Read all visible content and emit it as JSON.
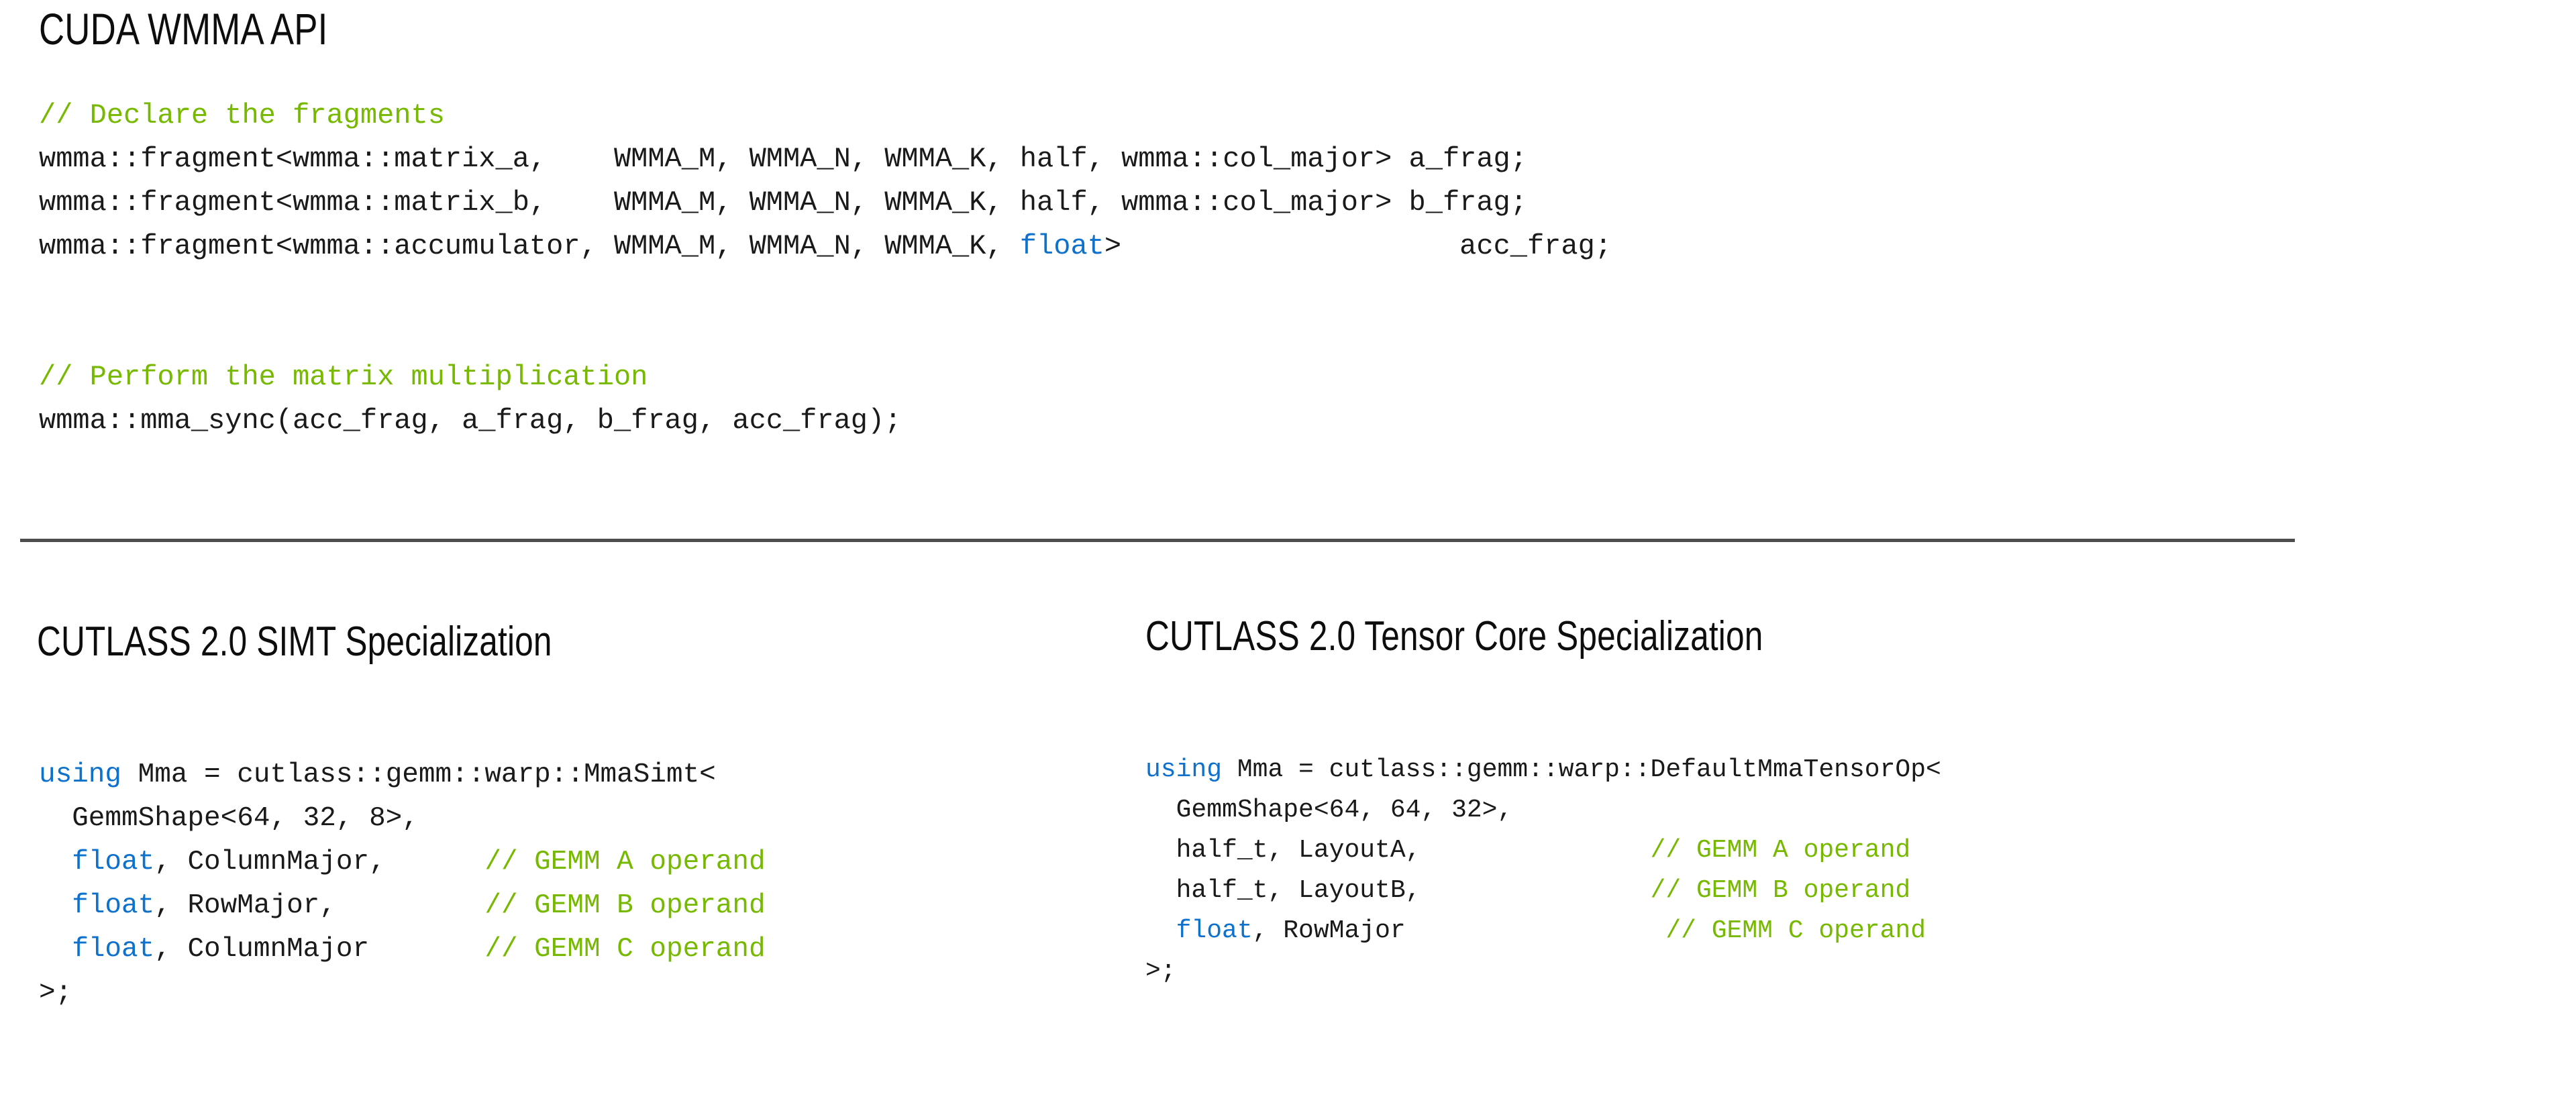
{
  "colors": {
    "comment_green": "#76b900",
    "keyword_blue": "#0e72cc",
    "code_text": "#1a1a1a",
    "heading_text": "#0d0d0d",
    "divider": "#4d4d4d",
    "background": "#ffffff"
  },
  "sections": {
    "top": {
      "heading": "CUDA WMMA API",
      "code_lines": [
        {
          "tokens": [
            {
              "t": "// Declare the fragments",
              "c": "cm"
            }
          ]
        },
        {
          "tokens": [
            {
              "t": "wmma::fragment<wmma::matrix_a,    WMMA_M, WMMA_N, WMMA_K, half, wmma::col_major> a_frag;",
              "c": "pl"
            }
          ]
        },
        {
          "tokens": [
            {
              "t": "wmma::fragment<wmma::matrix_b,    WMMA_M, WMMA_N, WMMA_K, half, wmma::col_major> b_frag;",
              "c": "pl"
            }
          ]
        },
        {
          "tokens": [
            {
              "t": "wmma::fragment<wmma::accumulator, WMMA_M, WMMA_N, WMMA_K, ",
              "c": "pl"
            },
            {
              "t": "float",
              "c": "kw"
            },
            {
              "t": ">                    acc_frag;",
              "c": "pl"
            }
          ]
        },
        {
          "tokens": [
            {
              "t": "",
              "c": "pl"
            }
          ]
        },
        {
          "tokens": [
            {
              "t": "",
              "c": "pl"
            }
          ]
        },
        {
          "tokens": [
            {
              "t": "// Perform the matrix multiplication",
              "c": "cm"
            }
          ]
        },
        {
          "tokens": [
            {
              "t": "wmma::mma_sync(acc_frag, a_frag, b_frag, acc_frag);",
              "c": "pl"
            }
          ]
        }
      ]
    },
    "left": {
      "heading": "CUTLASS 2.0 SIMT Specialization",
      "code_lines": [
        {
          "tokens": [
            {
              "t": "using",
              "c": "kw"
            },
            {
              "t": " Mma = cutlass::gemm::warp::MmaSimt<",
              "c": "pl"
            }
          ]
        },
        {
          "tokens": [
            {
              "t": "  GemmShape<64, 32, 8>,",
              "c": "pl"
            }
          ]
        },
        {
          "tokens": [
            {
              "t": "  ",
              "c": "pl"
            },
            {
              "t": "float",
              "c": "kw"
            },
            {
              "t": ", ColumnMajor,      ",
              "c": "pl"
            },
            {
              "t": "// GEMM A operand",
              "c": "cm"
            }
          ]
        },
        {
          "tokens": [
            {
              "t": "  ",
              "c": "pl"
            },
            {
              "t": "float",
              "c": "kw"
            },
            {
              "t": ", RowMajor,         ",
              "c": "pl"
            },
            {
              "t": "// GEMM B operand",
              "c": "cm"
            }
          ]
        },
        {
          "tokens": [
            {
              "t": "  ",
              "c": "pl"
            },
            {
              "t": "float",
              "c": "kw"
            },
            {
              "t": ", ColumnMajor       ",
              "c": "pl"
            },
            {
              "t": "// GEMM C operand",
              "c": "cm"
            }
          ]
        },
        {
          "tokens": [
            {
              "t": ">;",
              "c": "pl"
            }
          ]
        }
      ]
    },
    "right": {
      "heading": "CUTLASS 2.0 Tensor Core Specialization",
      "code_lines": [
        {
          "tokens": [
            {
              "t": "using",
              "c": "kw"
            },
            {
              "t": " Mma = cutlass::gemm::warp::DefaultMmaTensorOp<",
              "c": "pl"
            }
          ]
        },
        {
          "tokens": [
            {
              "t": "  GemmShape<64, 64, 32>,",
              "c": "pl"
            }
          ]
        },
        {
          "tokens": [
            {
              "t": "  half_t, LayoutA,               ",
              "c": "pl"
            },
            {
              "t": "// GEMM A operand",
              "c": "cm"
            }
          ]
        },
        {
          "tokens": [
            {
              "t": "  half_t, LayoutB,               ",
              "c": "pl"
            },
            {
              "t": "// GEMM B operand",
              "c": "cm"
            }
          ]
        },
        {
          "tokens": [
            {
              "t": "  ",
              "c": "pl"
            },
            {
              "t": "float",
              "c": "kw"
            },
            {
              "t": ", RowMajor                 ",
              "c": "pl"
            },
            {
              "t": "// GEMM C operand",
              "c": "cm"
            }
          ]
        },
        {
          "tokens": [
            {
              "t": ">;",
              "c": "pl"
            }
          ]
        }
      ]
    }
  }
}
